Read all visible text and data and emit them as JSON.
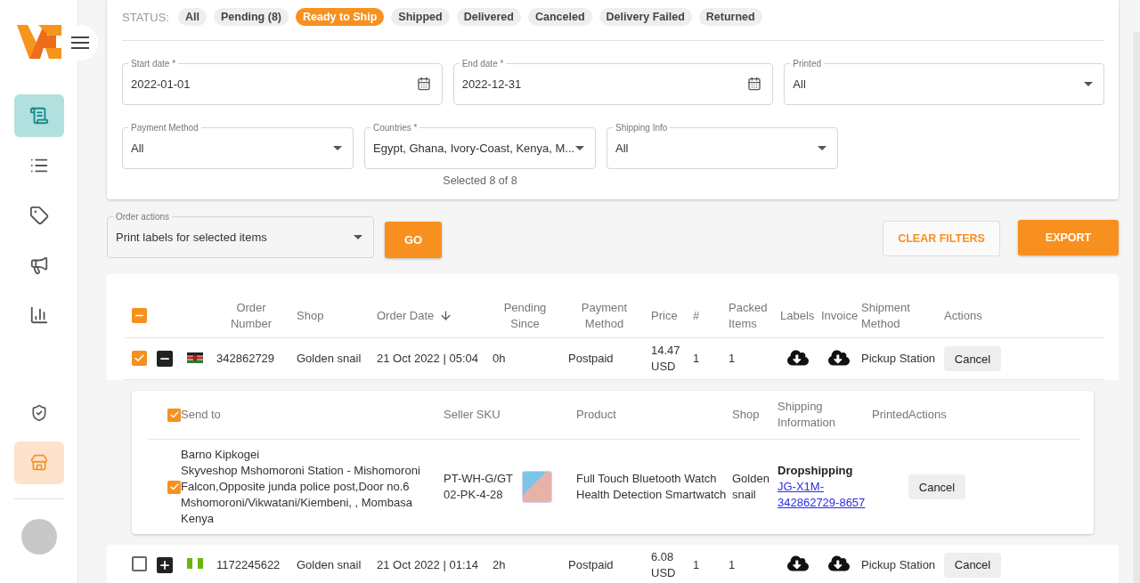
{
  "sidebar": {
    "nav_items": [
      {
        "selected": true
      },
      {
        "selected": false
      },
      {
        "selected": false
      },
      {
        "selected": false
      },
      {
        "selected": false
      }
    ],
    "bottom_items": [
      {
        "highlighted": false
      },
      {
        "highlighted": true
      }
    ]
  },
  "filters": {
    "status_label": "STATUS:",
    "statuses": [
      {
        "label": "All",
        "selected": false
      },
      {
        "label": "Pending (8)",
        "selected": false
      },
      {
        "label": "Ready to Ship",
        "selected": true
      },
      {
        "label": "Shipped",
        "selected": false
      },
      {
        "label": "Delivered",
        "selected": false
      },
      {
        "label": "Canceled",
        "selected": false
      },
      {
        "label": "Delivery Failed",
        "selected": false
      },
      {
        "label": "Returned",
        "selected": false
      }
    ],
    "row_1": [
      {
        "kind": "date",
        "label": "Start date *",
        "value": "2022-01-01"
      },
      {
        "kind": "date",
        "label": "End date *",
        "value": "2022-12-31"
      },
      {
        "kind": "select",
        "label": "Printed",
        "value": "All"
      }
    ],
    "row_2": [
      {
        "kind": "select",
        "label": "Payment Method",
        "value": "All"
      },
      {
        "kind": "select",
        "label": "Countries *",
        "value": "Egypt, Ghana, Ivory-Coast, Kenya, M...",
        "helper": "Selected 8 of 8"
      },
      {
        "kind": "select",
        "label": "Shipping Info",
        "value": "All"
      }
    ]
  },
  "order_actions": {
    "label": "Order actions",
    "value": "Print labels for selected items",
    "go": "GO",
    "clear": "CLEAR FILTERS",
    "export": "EXPORT"
  },
  "table": {
    "select_all": {
      "indeterminate": true
    },
    "columns": [
      "Order Number",
      "Shop",
      "Order Date",
      "Pending Since",
      "Payment Method",
      "Price",
      "#",
      "Packed Items",
      "Labels",
      "Invoice",
      "Shipment Method",
      "Actions"
    ],
    "rows": [
      {
        "checked": true,
        "expanded": true,
        "order_number": "342862729",
        "shop": "Golden snail",
        "order_date": "21 Oct 2022 | 05:04",
        "pending_since": "0h",
        "payment_method": "Postpaid",
        "price": "14.47 USD",
        "count": "1",
        "packed_items": "1",
        "shipment": "Pickup Station",
        "action": "Cancel",
        "items": {
          "columns": [
            "Send to",
            "Seller SKU",
            "Product",
            "Shop",
            "Shipping Information",
            "Printed",
            "Actions"
          ],
          "header_checked": true,
          "rows": [
            {
              "checked": true,
              "send_to": [
                "Barno Kipkogei",
                "Skyveshop Mshomoroni Station - Mishomoroni",
                "Falcon,Opposite junda police post,Door no.6",
                "Mshomoroni/Vikwatani/Kiembeni, , Mombasa",
                "Kenya"
              ],
              "sku": "PT-WH-G/GT02-PK-4-28",
              "product": "Full Touch Bluetooth Watch Health Detection Smartwatch",
              "shop": "Golden snail",
              "shipping_type": "Dropshipping",
              "tracking": "JG-X1M-342862729-8657",
              "action": "Cancel"
            }
          ]
        }
      },
      {
        "checked": false,
        "expanded": false,
        "order_number": "1172245622",
        "shop": "Golden snail",
        "order_date": "21 Oct 2022 | 01:14",
        "pending_since": "2h",
        "payment_method": "Postpaid",
        "price": "6.08 USD",
        "count": "1",
        "packed_items": "1",
        "shipment": "Pickup Station",
        "action": "Cancel"
      }
    ]
  }
}
